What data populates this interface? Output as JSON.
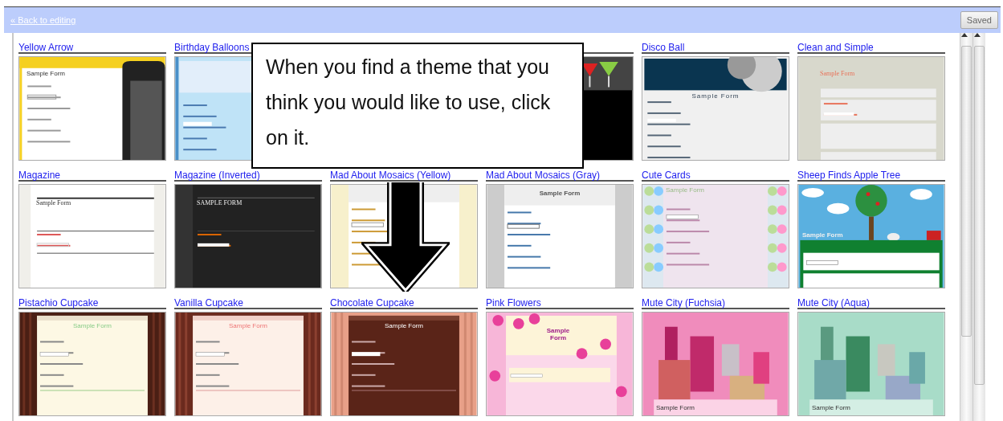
{
  "top_bar": {
    "back_link": "« Back to editing",
    "saved_button": "Saved"
  },
  "themes": [
    {
      "kind": "arrow",
      "title": "Yellow Arrow",
      "preview_title": "Sample Form"
    },
    {
      "kind": "balloons",
      "title": "Birthday Balloons"
    },
    {
      "kind": "covered"
    },
    {
      "kind": "martini"
    },
    {
      "kind": "disco",
      "title": "Disco Ball",
      "preview_title": "Sample Form"
    },
    {
      "kind": "clean",
      "title": "Clean and Simple",
      "preview_title": "Sample Form"
    },
    {
      "kind": "magazine",
      "title": "Magazine",
      "preview_title": "Sample Form"
    },
    {
      "kind": "inverted",
      "title": "Magazine (Inverted)",
      "preview_title": "SAMPLE FORM"
    },
    {
      "kind": "mosaicyellow",
      "title": "Mad About Mosaics (Yellow)"
    },
    {
      "kind": "mosaicgray",
      "title": "Mad About Mosaics (Gray)",
      "preview_title": "Sample Form"
    },
    {
      "kind": "cards",
      "title": "Cute Cards",
      "preview_title": "Sample Form"
    },
    {
      "kind": "sheep",
      "title": "Sheep Finds Apple Tree",
      "preview_title": "Sample Form"
    },
    {
      "kind": "pistachio",
      "title": "Pistachio Cupcake",
      "preview_title": "Sample Form"
    },
    {
      "kind": "vanilla",
      "title": "Vanilla Cupcake",
      "preview_title": "Sample Form"
    },
    {
      "kind": "chocolate",
      "title": "Chocolate Cupcake",
      "preview_title": "Sample Form"
    },
    {
      "kind": "flowers",
      "title": "Pink Flowers",
      "preview_title": "Sample Form"
    },
    {
      "kind": "fuchsia",
      "title": "Mute City (Fuchsia)",
      "preview_title": "Sample Form"
    },
    {
      "kind": "aqua",
      "title": "Mute City (Aqua)",
      "preview_title": "Sample Form"
    }
  ],
  "callout": {
    "text": "When you find a theme that you think you would like to use, click on it."
  }
}
